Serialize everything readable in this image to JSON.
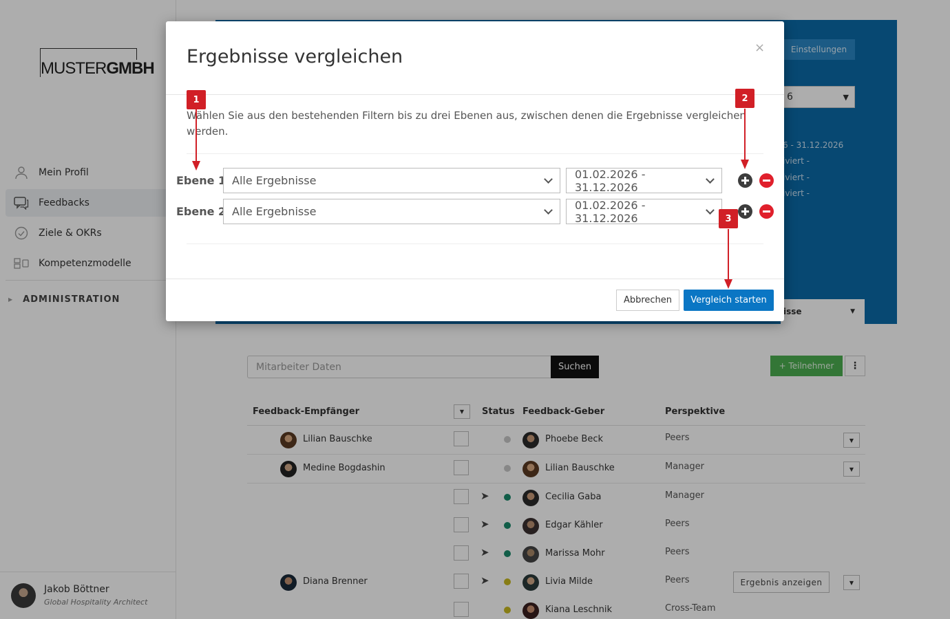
{
  "sidebar": {
    "logo": {
      "part1": "MUSTER",
      "part2": "GMBH"
    },
    "items": [
      {
        "label": "Mein Profil",
        "icon": "user-icon"
      },
      {
        "label": "Feedbacks",
        "icon": "chat-bubbles-icon"
      },
      {
        "label": "Ziele & OKRs",
        "icon": "check-circle-icon"
      },
      {
        "label": "Kompetenzmodelle",
        "icon": "model-icon"
      }
    ],
    "admin_label": "ADMINISTRATION",
    "user": {
      "name": "Jakob Böttner",
      "role": "Global Hospitality Architect"
    }
  },
  "background": {
    "settings_button": "Einstellungen",
    "period_select": "6",
    "period_texts": [
      "6 - 31.12.2026",
      "iviert -",
      "iviert -",
      "iviert -"
    ],
    "tab_label": "isse",
    "search_placeholder": "Mitarbeiter Daten",
    "search_button": "Suchen",
    "add_participant_button": "+ Teilnehmer",
    "more_button": "⋮",
    "table": {
      "headers": {
        "recipient": "Feedback-Empfänger",
        "status": "Status",
        "giver": "Feedback-Geber",
        "perspective": "Perspektive"
      },
      "rows": [
        {
          "recipient": "Lilian Bauschke",
          "giver": "Phoebe Beck",
          "perspective": "Peers",
          "status_color": "#c8c8c8",
          "sent": false
        },
        {
          "recipient": "Medine Bogdashin",
          "giver": "Lilian Bauschke",
          "perspective": "Manager",
          "status_color": "#c8c8c8",
          "sent": false
        },
        {
          "recipient": "",
          "giver": "Cecilia Gaba",
          "perspective": "Manager",
          "status_color": "#1a8a6a",
          "sent": true
        },
        {
          "recipient": "",
          "giver": "Edgar Kähler",
          "perspective": "Peers",
          "status_color": "#1a8a6a",
          "sent": true
        },
        {
          "recipient": "",
          "giver": "Marissa Mohr",
          "perspective": "Peers",
          "status_color": "#1a8a6a",
          "sent": true
        },
        {
          "recipient": "Diana Brenner",
          "giver": "Livia Milde",
          "perspective": "Peers",
          "status_color": "#c8b820",
          "sent": true
        },
        {
          "recipient": "",
          "giver": "Kiana Leschnik",
          "perspective": "Cross-Team",
          "status_color": "#c8b820",
          "sent": false
        }
      ],
      "result_button": "Ergebnis anzeigen"
    }
  },
  "modal": {
    "title": "Ergebnisse vergleichen",
    "close": "×",
    "description": "Wählen Sie aus den bestehenden Filtern bis zu drei Ebenen aus, zwischen denen die Ergebnisse vergleichen werden.",
    "levels": [
      {
        "label": "Ebene 1",
        "filter": "Alle Ergebnisse",
        "date_range": "01.02.2026 - 31.12.2026"
      },
      {
        "label": "Ebene 2",
        "filter": "Alle Ergebnisse",
        "date_range": "01.02.2026 - 31.12.2026"
      }
    ],
    "cancel_button": "Abbrechen",
    "start_button": "Vergleich starten"
  },
  "annotations": {
    "badges": [
      "1",
      "2",
      "3"
    ],
    "color": "#d11f26"
  }
}
